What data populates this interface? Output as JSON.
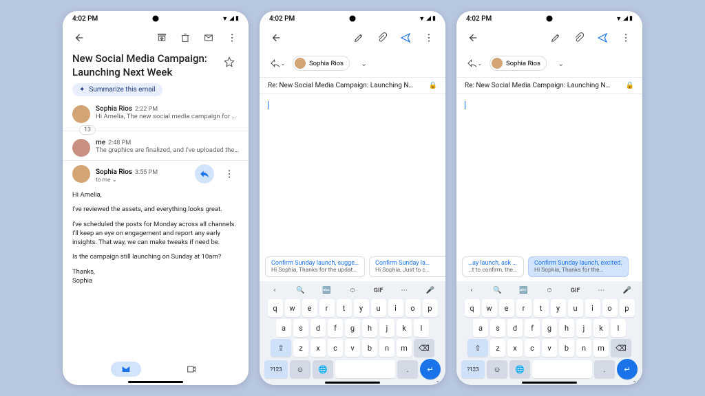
{
  "status": {
    "time": "4:02 PM"
  },
  "email": {
    "subject": "New Social Media Campaign: Launching Next Week",
    "summarize_label": "Summarize this email",
    "thread_count": "13",
    "messages": [
      {
        "sender": "Sophia Rios",
        "time": "2:22 PM",
        "preview": "Hi Amelia, The new social media campaign for ou…"
      },
      {
        "sender": "me",
        "time": "2:48 PM",
        "preview": "The graphics are finalized, and I've uploaded the…"
      }
    ],
    "expanded": {
      "sender": "Sophia Rios",
      "time": "3:55 PM",
      "to": "to me",
      "greeting": "Hi Amelia,",
      "p1": "I've reviewed the assets, and everything looks great.",
      "p2": "I've scheduled the posts for Monday across all channels. I'll keep an eye on engagement and report any early insights. That way, we can make tweaks if need be.",
      "p3": "Is the campaign still launching on Sunday at 10am?",
      "closing1": "Thanks,",
      "closing2": "Sophia"
    }
  },
  "compose": {
    "recipient": "Sophia Rios",
    "subject": "Re: New Social Media Campaign: Launching N…"
  },
  "suggestions_a": [
    {
      "title": "Confirm Sunday launch, sugge…",
      "body": "Hi Sophia, Thanks for the updat…"
    },
    {
      "title": "Confirm Sunday la…",
      "body": "Hi Sophia, Just to c…"
    }
  ],
  "suggestions_b": [
    {
      "title": "…ay launch, ask goals",
      "body": "…t to confirm, the…"
    },
    {
      "title": "Confirm Sunday launch, excited.",
      "body": "Hi Sophia, Thanks for the…"
    }
  ],
  "keyboard": {
    "row1": [
      "q",
      "w",
      "e",
      "r",
      "t",
      "y",
      "u",
      "i",
      "o",
      "p"
    ],
    "row2": [
      "a",
      "s",
      "d",
      "f",
      "g",
      "h",
      "j",
      "k",
      "l"
    ],
    "row3": [
      "z",
      "x",
      "c",
      "v",
      "b",
      "n",
      "m"
    ],
    "sym": "?123",
    "gif": "GIF"
  }
}
